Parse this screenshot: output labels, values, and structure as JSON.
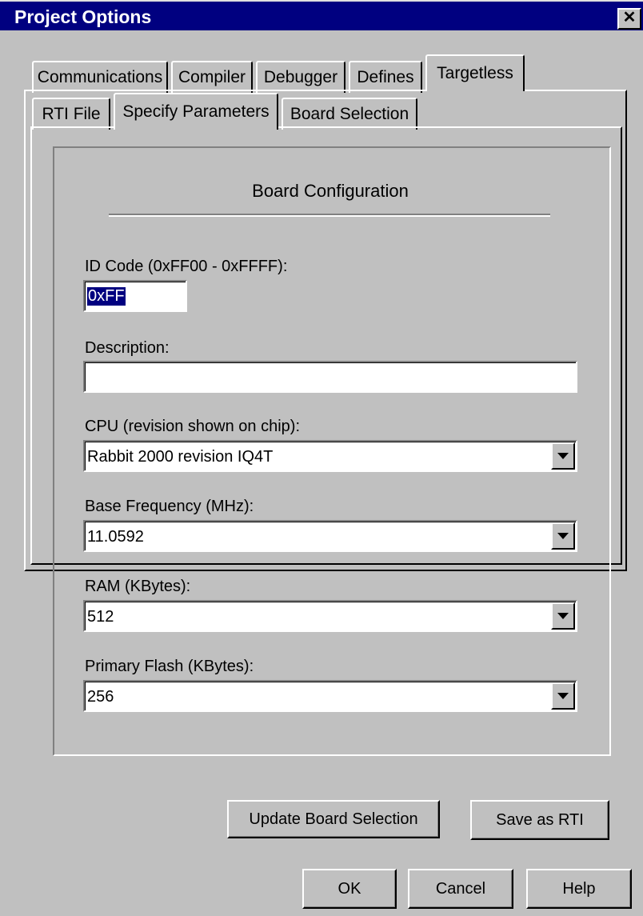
{
  "window": {
    "title": "Project Options",
    "close_glyph": "✕"
  },
  "tabs_top": [
    {
      "label": "Communications"
    },
    {
      "label": "Compiler"
    },
    {
      "label": "Debugger"
    },
    {
      "label": "Defines"
    },
    {
      "label": "Targetless",
      "active": true
    }
  ],
  "tabs_sub": [
    {
      "label": "RTI File"
    },
    {
      "label": "Specify Parameters",
      "active": true
    },
    {
      "label": "Board Selection"
    }
  ],
  "board_config": {
    "heading": "Board Configuration",
    "id_code": {
      "label": "ID Code (0xFF00 - 0xFFFF):",
      "value": "0xFF"
    },
    "description": {
      "label": "Description:",
      "value": ""
    },
    "cpu": {
      "label": "CPU (revision shown on chip):",
      "value": "Rabbit 2000 revision IQ4T"
    },
    "base_frequency": {
      "label": "Base Frequency (MHz):",
      "value": "11.0592"
    },
    "ram": {
      "label": "RAM (KBytes):",
      "value": "512"
    },
    "flash": {
      "label": "Primary Flash (KBytes):",
      "value": "256"
    }
  },
  "actions": {
    "update_board_selection": "Update Board Selection",
    "save_as_rti": "Save as RTI"
  },
  "footer": {
    "ok": "OK",
    "cancel": "Cancel",
    "help": "Help"
  }
}
